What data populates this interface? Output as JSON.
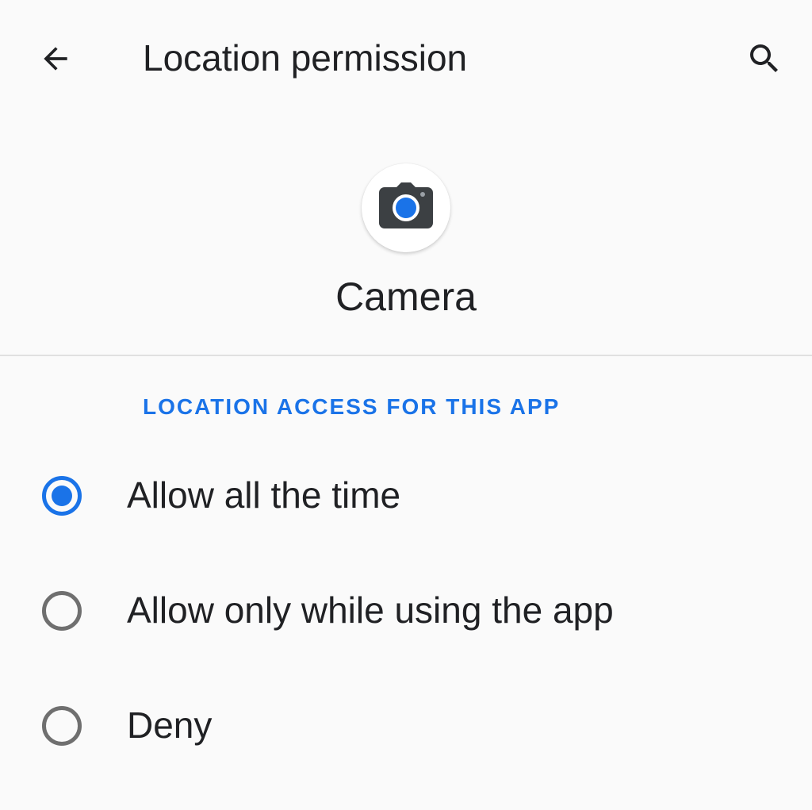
{
  "app_bar": {
    "title": "Location permission",
    "back_icon": "arrow-back-icon",
    "search_icon": "search-icon"
  },
  "app": {
    "name": "Camera",
    "icon": "camera-icon"
  },
  "section": {
    "header": "LOCATION ACCESS FOR THIS APP"
  },
  "options": [
    {
      "label": "Allow all the time",
      "selected": true
    },
    {
      "label": "Allow only while using the app",
      "selected": false
    },
    {
      "label": "Deny",
      "selected": false
    }
  ],
  "colors": {
    "accent": "#1a73e8",
    "background": "#fafafa",
    "text_primary": "#202124",
    "radio_unchecked": "#6f6f6f",
    "divider": "#e0e0e0"
  }
}
